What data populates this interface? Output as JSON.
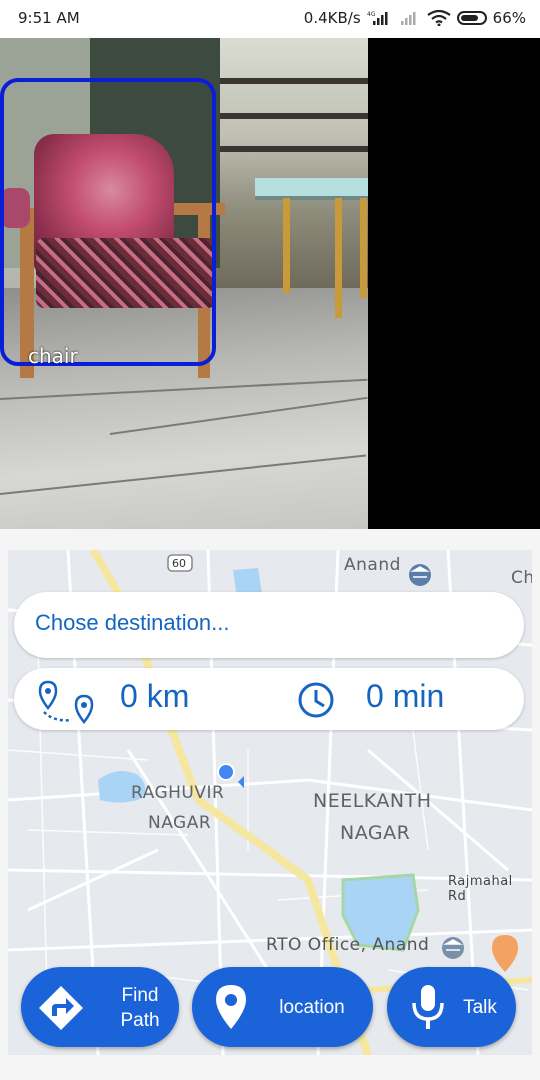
{
  "status_bar": {
    "time": "9:51 AM",
    "net_speed": "0.4KB/s",
    "network_type": "4G",
    "battery": "66%"
  },
  "camera": {
    "detections": [
      {
        "label": "chair",
        "box_color": "#0a1ed8"
      }
    ]
  },
  "map": {
    "labels": {
      "road_number": "60",
      "anand": "Anand",
      "ch_partial": "Ch",
      "raghuvir_1": "RAGHUVIR",
      "raghuvir_2": "NAGAR",
      "neelkanth_1": "NEELKANTH",
      "neelkanth_2": "NAGAR",
      "rajmahal": "Rajmahal Rd",
      "rto": "RTO Office, Anand"
    },
    "destination": {
      "placeholder": "Chose destination..."
    },
    "trip": {
      "distance": "0 km",
      "duration": "0 min"
    }
  },
  "actions": {
    "find_path_line1": "Find",
    "find_path_line2": "Path",
    "location": "location",
    "talk": "Talk"
  },
  "colors": {
    "accent": "#1a63d8",
    "text_blue": "#1565c0",
    "map_bg": "#e6e9ed"
  }
}
